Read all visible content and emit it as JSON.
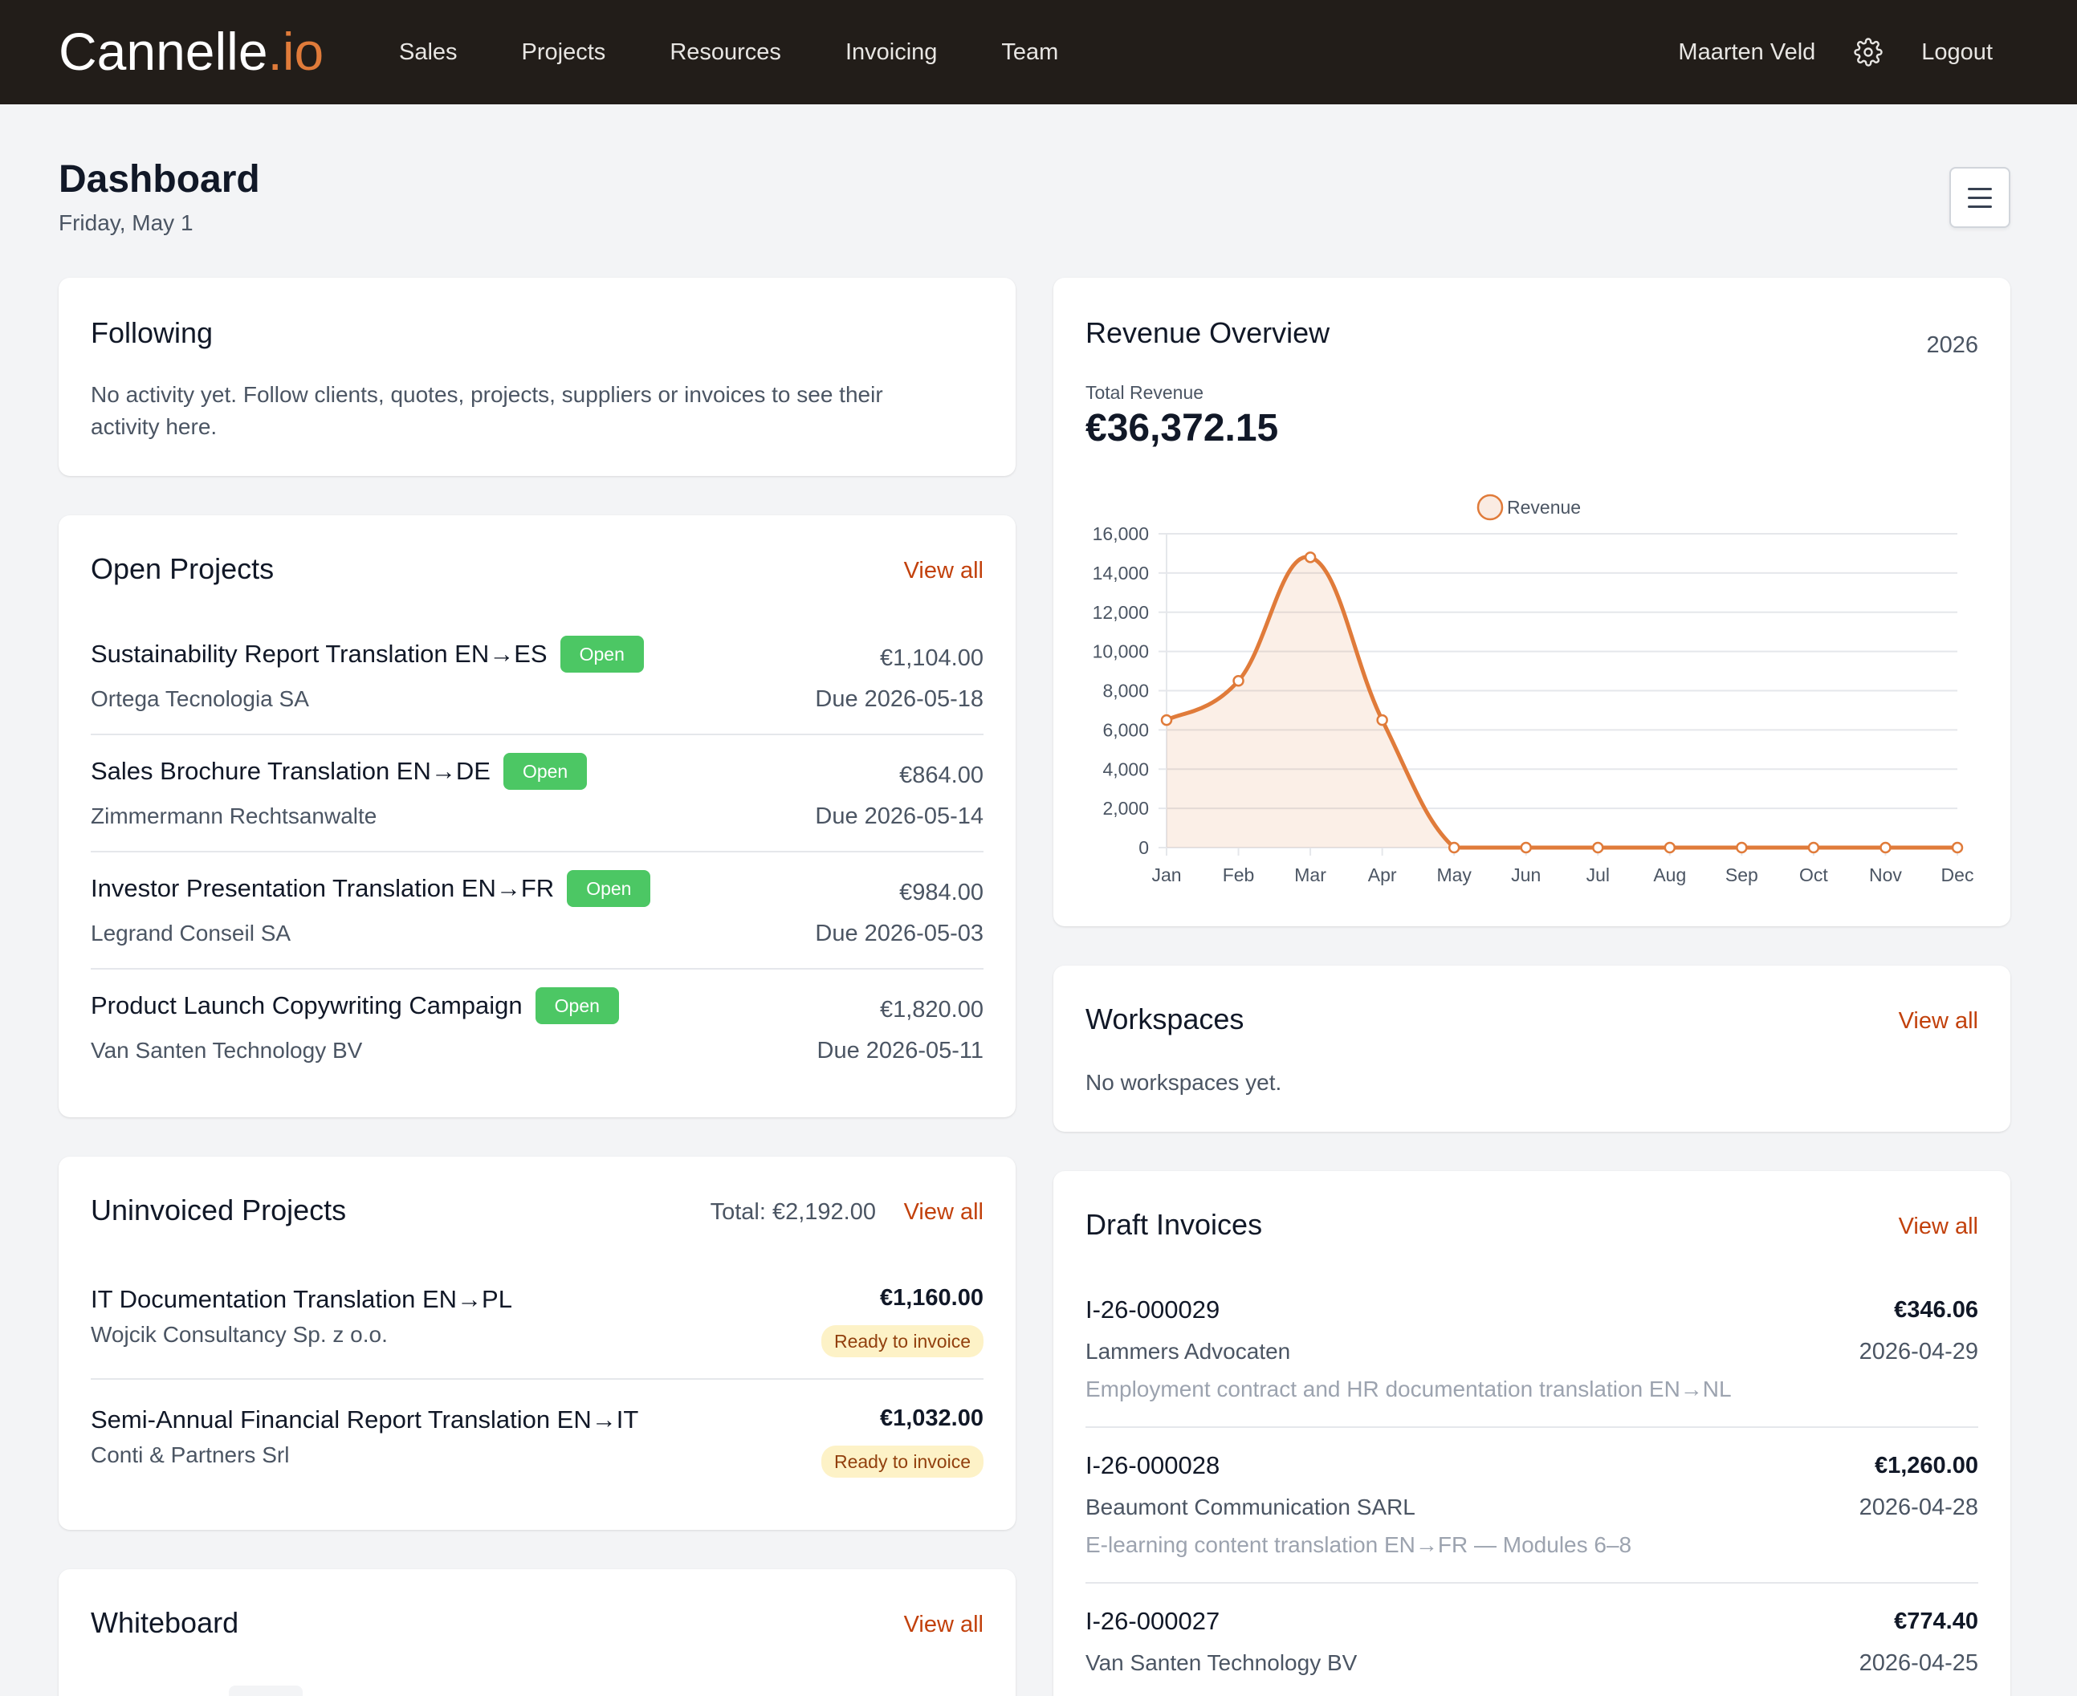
{
  "nav": {
    "brand_main": "Cannelle",
    "brand_dot": ".io",
    "links": [
      "Sales",
      "Projects",
      "Resources",
      "Invoicing",
      "Team"
    ],
    "user": "Maarten Veld",
    "logout": "Logout"
  },
  "header": {
    "title": "Dashboard",
    "date": "Friday, May 1"
  },
  "following": {
    "title": "Following",
    "empty_line1": "No activity yet. Follow clients, quotes, projects, suppliers or invoices to see their",
    "empty_line2": "activity here."
  },
  "open_projects": {
    "title": "Open Projects",
    "view_all": "View all",
    "items": [
      {
        "name": "Sustainability Report Translation EN→ES",
        "status": "Open",
        "client": "Ortega Tecnologia SA",
        "amount": "€1,104.00",
        "due": "Due 2026-05-18"
      },
      {
        "name": "Sales Brochure Translation EN→DE",
        "status": "Open",
        "client": "Zimmermann Rechtsanwalte",
        "amount": "€864.00",
        "due": "Due 2026-05-14"
      },
      {
        "name": "Investor Presentation Translation EN→FR",
        "status": "Open",
        "client": "Legrand Conseil SA",
        "amount": "€984.00",
        "due": "Due 2026-05-03"
      },
      {
        "name": "Product Launch Copywriting Campaign",
        "status": "Open",
        "client": "Van Santen Technology BV",
        "amount": "€1,820.00",
        "due": "Due 2026-05-11"
      }
    ]
  },
  "uninvoiced": {
    "title": "Uninvoiced Projects",
    "total": "Total: €2,192.00",
    "view_all": "View all",
    "items": [
      {
        "name": "IT Documentation Translation EN→PL",
        "client": "Wojcik Consultancy Sp. z o.o.",
        "amount": "€1,160.00",
        "status": "Ready to invoice"
      },
      {
        "name": "Semi-Annual Financial Report Translation EN→IT",
        "client": "Conti & Partners Srl",
        "amount": "€1,032.00",
        "status": "Ready to invoice"
      }
    ]
  },
  "whiteboard": {
    "title": "Whiteboard",
    "view_all": "View all"
  },
  "revenue": {
    "title": "Revenue Overview",
    "year": "2026",
    "total_label": "Total Revenue",
    "total": "€36,372.15"
  },
  "chart_data": {
    "type": "area",
    "legend": "top",
    "grid": true,
    "categories": [
      "Jan",
      "Feb",
      "Mar",
      "Apr",
      "May",
      "Jun",
      "Jul",
      "Aug",
      "Sep",
      "Oct",
      "Nov",
      "Dec"
    ],
    "series": [
      {
        "name": "Revenue",
        "values": [
          6500,
          8500,
          14800,
          6500,
          0,
          0,
          0,
          0,
          0,
          0,
          0,
          0
        ]
      }
    ],
    "ylim": [
      0,
      16000
    ],
    "yticks": [
      0,
      2000,
      4000,
      6000,
      8000,
      10000,
      12000,
      14000,
      16000
    ],
    "ytick_labels": [
      "0",
      "2,000",
      "4,000",
      "6,000",
      "8,000",
      "10,000",
      "12,000",
      "14,000",
      "16,000"
    ],
    "color": "#e07b3a"
  },
  "workspaces": {
    "title": "Workspaces",
    "view_all": "View all",
    "empty": "No workspaces yet."
  },
  "drafts": {
    "title": "Draft Invoices",
    "view_all": "View all",
    "items": [
      {
        "number": "I-26-000029",
        "client": "Lammers Advocaten",
        "amount": "€346.06",
        "date": "2026-04-29",
        "desc": "Employment contract and HR documentation translation EN→NL"
      },
      {
        "number": "I-26-000028",
        "client": "Beaumont Communication SARL",
        "amount": "€1,260.00",
        "date": "2026-04-28",
        "desc": "E-learning content translation EN→FR — Modules 6–8"
      },
      {
        "number": "I-26-000027",
        "client": "Van Santen Technology BV",
        "amount": "€774.40",
        "date": "2026-04-25"
      }
    ]
  }
}
